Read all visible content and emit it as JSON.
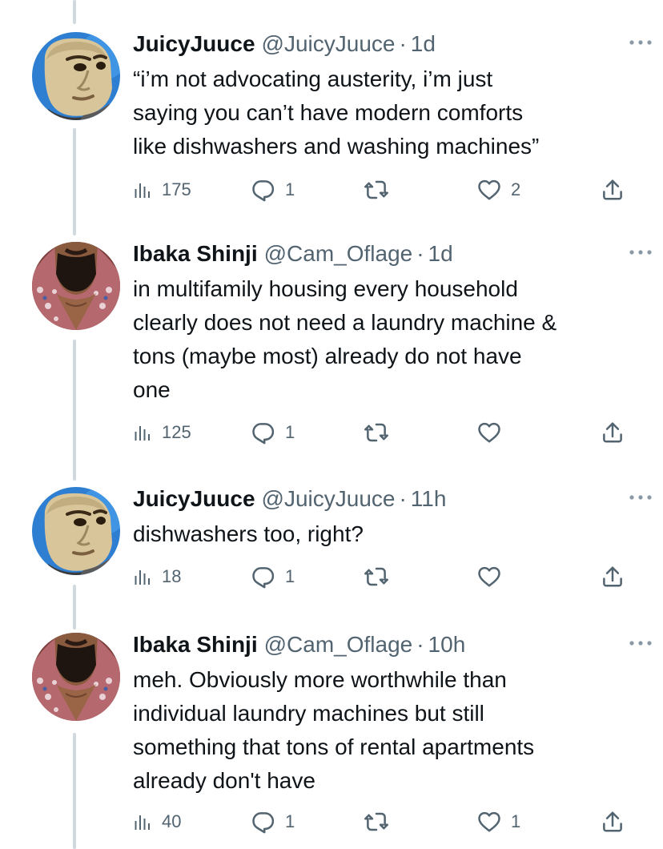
{
  "tweets": [
    {
      "name": "JuicyJuuce",
      "handle": "@JuicyJuuce",
      "dot": "·",
      "time": "1d",
      "text": "“i’m not advocating austerity, i’m just\nsaying you can’t have modern comforts\nlike dishwashers and washing machines”",
      "views": "175",
      "replies": "1",
      "retweets": "",
      "likes": "2",
      "avatar": "cartoon-man"
    },
    {
      "name": "Ibaka Shinji",
      "handle": "@Cam_Oflage",
      "dot": "·",
      "time": "1d",
      "text": "in multifamily housing every household\nclearly does not need a laundry machine &\ntons (maybe most) already do not have\none",
      "views": "125",
      "replies": "1",
      "retweets": "",
      "likes": "",
      "avatar": "bearded-man"
    },
    {
      "name": "JuicyJuuce",
      "handle": "@JuicyJuuce",
      "dot": "·",
      "time": "11h",
      "text": "dishwashers too, right?",
      "views": "18",
      "replies": "1",
      "retweets": "",
      "likes": "",
      "avatar": "cartoon-man"
    },
    {
      "name": "Ibaka Shinji",
      "handle": "@Cam_Oflage",
      "dot": "·",
      "time": "10h",
      "text": "meh. Obviously more worthwhile than\nindividual laundry machines but still\nsomething that tons of rental apartments\nalready don't have",
      "views": "40",
      "replies": "1",
      "retweets": "",
      "likes": "1",
      "avatar": "bearded-man"
    }
  ],
  "icons": {
    "views": "views-icon",
    "reply": "reply-icon",
    "retweet": "retweet-icon",
    "like": "heart-icon",
    "share": "share-icon",
    "more": "more-icon"
  },
  "colors": {
    "text": "#0f1419",
    "secondary": "#536471",
    "thread_line": "#cfd9de"
  }
}
